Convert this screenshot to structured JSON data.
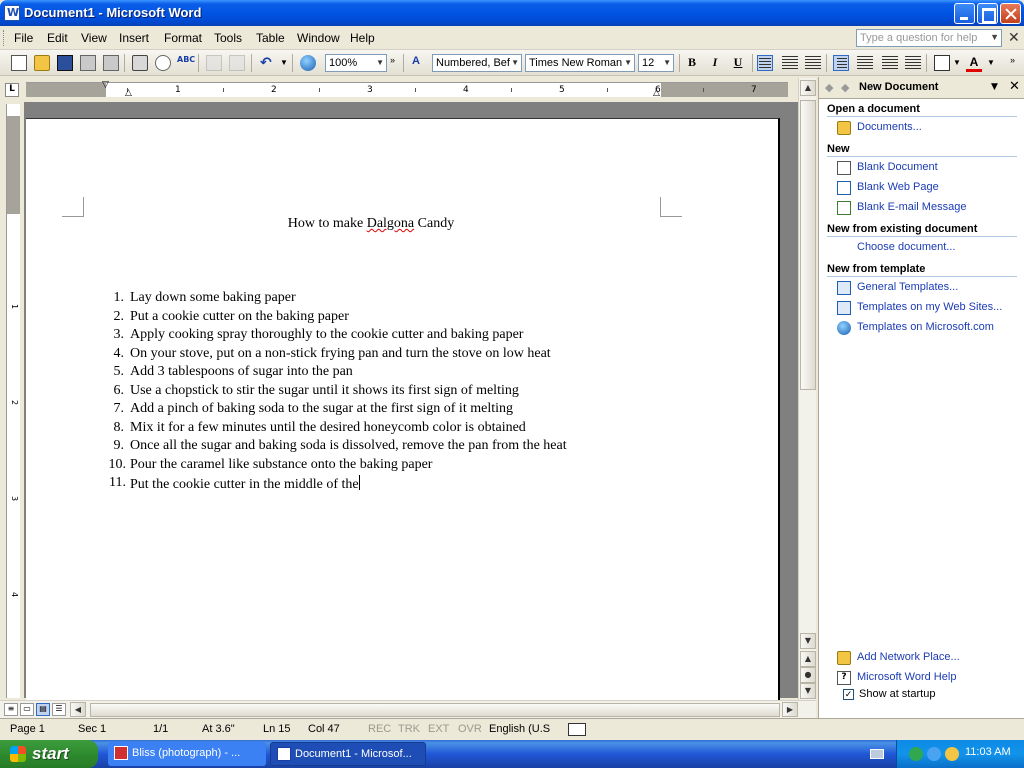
{
  "window": {
    "title": "Document1 - Microsoft Word"
  },
  "menu": {
    "items": [
      "File",
      "Edit",
      "View",
      "Insert",
      "Format",
      "Tools",
      "Table",
      "Window",
      "Help"
    ],
    "help_placeholder": "Type a question for help"
  },
  "toolbar": {
    "zoom": "100%",
    "style": "Numbered, Bef",
    "font": "Times New Roman",
    "size": "12",
    "bold": "B",
    "italic": "I",
    "underline": "U",
    "font_color_glyph": "A",
    "spell_glyph": "ABC"
  },
  "ruler": {
    "corner": "L",
    "numbers": [
      "1",
      "2",
      "3",
      "4",
      "5",
      "6",
      "7"
    ],
    "vnumbers": [
      "1",
      "2",
      "3",
      "4"
    ]
  },
  "document": {
    "title_before": "How to make ",
    "title_misspelled": "Dalgona",
    "title_after": " Candy",
    "items": [
      {
        "n": "1.",
        "t": "Lay down some baking paper"
      },
      {
        "n": "2.",
        "t": "Put a cookie cutter on the baking paper"
      },
      {
        "n": "3.",
        "t": "Apply cooking spray thoroughly to the cookie cutter and baking paper"
      },
      {
        "n": "4.",
        "t": "On your stove, put on a non-stick frying pan and turn the stove on low heat"
      },
      {
        "n": "5.",
        "t": "Add 3 tablespoons of sugar into the pan"
      },
      {
        "n": "6.",
        "t": "Use a chopstick to stir the sugar until it shows its first sign of melting"
      },
      {
        "n": "7.",
        "t": "Add a pinch of baking soda to the sugar at the first sign of it melting"
      },
      {
        "n": "8.",
        "t": "Mix it for a few minutes until the desired honeycomb color is obtained"
      },
      {
        "n": "9.",
        "t": "Once all the sugar and baking soda is dissolved, remove the pan from the heat"
      },
      {
        "n": "10.",
        "t": "Pour the caramel like substance onto the baking paper"
      },
      {
        "n": "11.",
        "t": "Put the cookie cutter in the middle of the"
      }
    ]
  },
  "taskpane": {
    "title": "New Document",
    "sections": {
      "open": "Open a document",
      "new": "New",
      "existing": "New from existing document",
      "template": "New from template"
    },
    "links": {
      "documents": "Documents...",
      "blank_doc": "Blank Document",
      "blank_web": "Blank Web Page",
      "blank_email": "Blank E-mail Message",
      "choose": "Choose document...",
      "general": "General Templates...",
      "web_sites": "Templates on my Web Sites...",
      "microsoft": "Templates on Microsoft.com",
      "network": "Add Network Place...",
      "help": "Microsoft Word Help"
    },
    "show_startup": "Show at startup"
  },
  "status": {
    "page": "Page 1",
    "sec": "Sec 1",
    "pages": "1/1",
    "at": "At 3.6\"",
    "ln": "Ln 15",
    "col": "Col 47",
    "rec": "REC",
    "trk": "TRK",
    "ext": "EXT",
    "ovr": "OVR",
    "lang": "English (U.S"
  },
  "taskbar": {
    "start": "start",
    "task1": "Bliss (photograph) - ...",
    "task2": "Document1 - Microsof...",
    "clock": "11:03 AM"
  }
}
